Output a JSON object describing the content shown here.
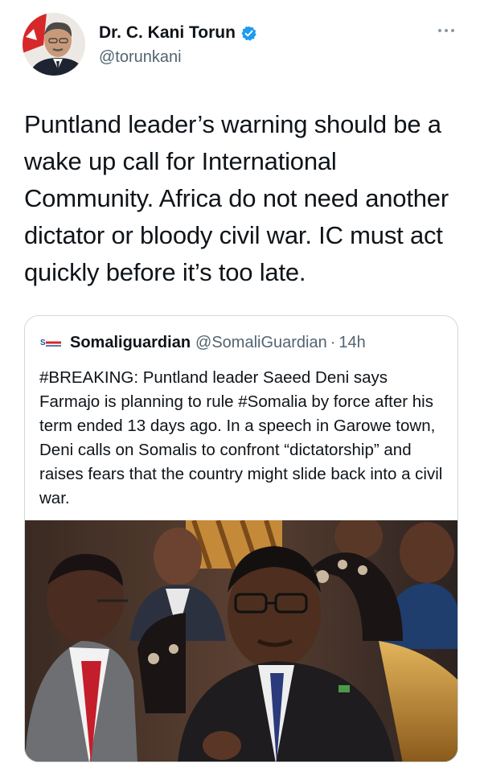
{
  "author": {
    "display_name": "Dr. C. Kani Torun",
    "handle": "@torunkani",
    "verified": true,
    "avatar_icon": "profile-photo-avatar"
  },
  "menu": {
    "icon": "more-dots-icon"
  },
  "tweet": {
    "text": "Puntland leader’s warning should be a wake up call for International Community. Africa do not need another dictator or bloody civil war. IC must act quickly before it’s too late."
  },
  "quoted": {
    "logo_icon": "somaliguardian-logo-icon",
    "name": "Somaliguardian",
    "handle": "@SomaliGuardian",
    "separator": "·",
    "time": "14h",
    "text": "#BREAKING: Puntland leader Saeed Deni says Farmajo is planning to rule #Somalia by force after his term ended 13 days ago. In a speech in Garowe town, Deni calls on Somalis to confront “dictatorship” and raises fears that the country might slide back into a civil war."
  },
  "colors": {
    "text": "#0f1419",
    "secondary": "#536471",
    "verified_blue": "#1d9bf0",
    "border": "#cfd9de"
  }
}
